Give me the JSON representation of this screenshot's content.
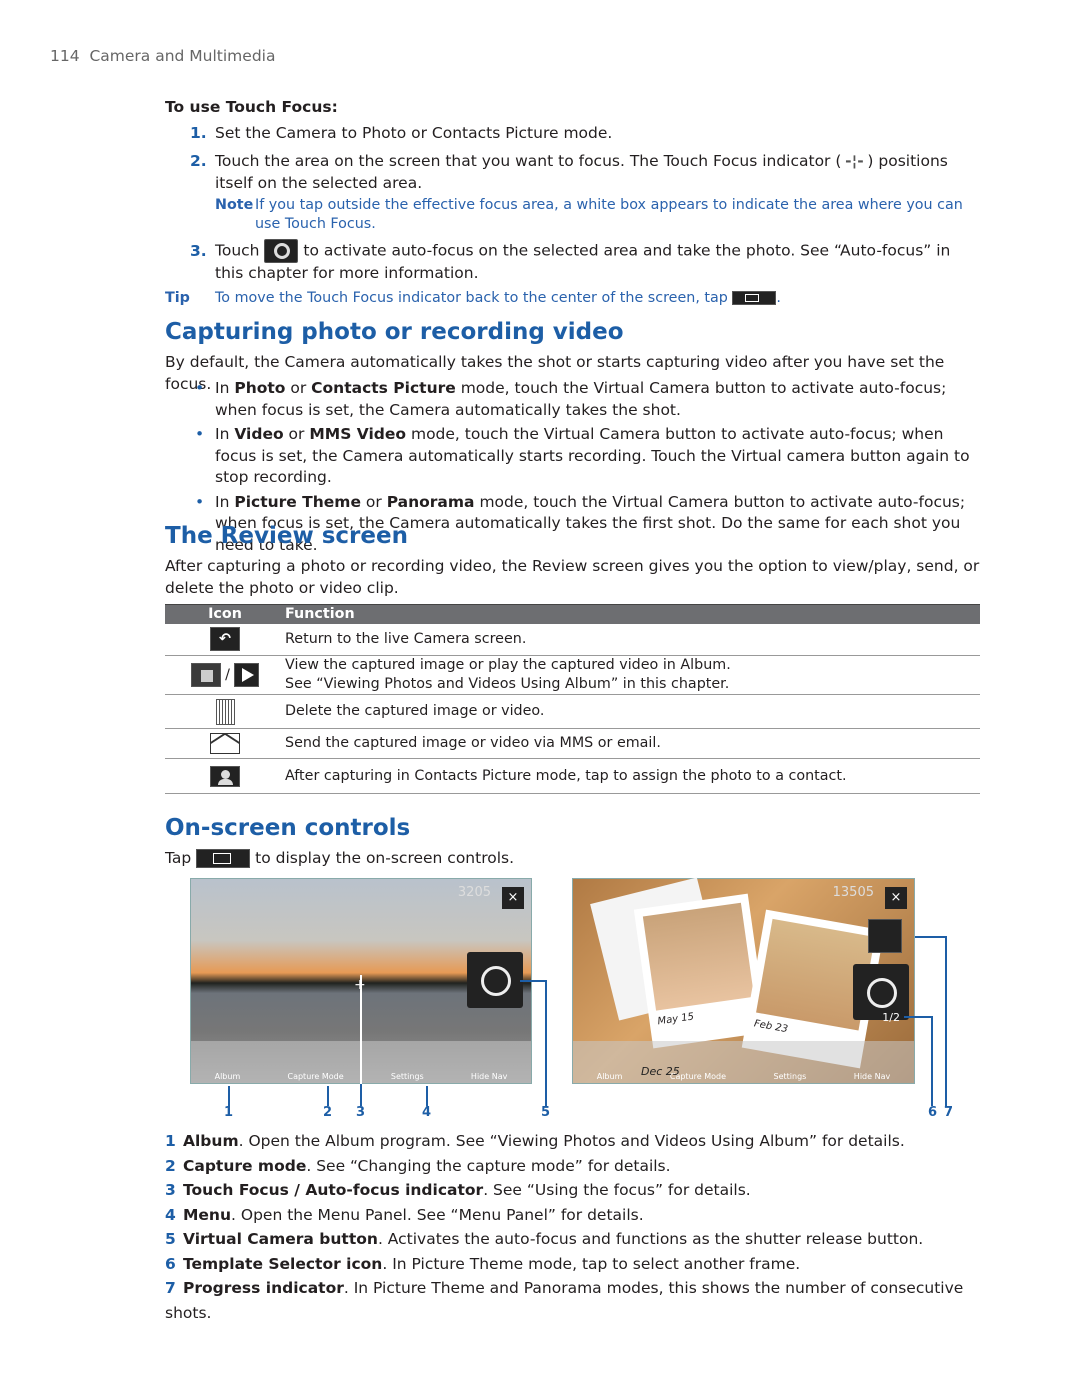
{
  "header": {
    "page_number": "114",
    "chapter": "Camera and Multimedia"
  },
  "touch_focus": {
    "heading": "To use Touch Focus:",
    "steps": [
      {
        "n": "1.",
        "text": "Set the Camera to Photo or Contacts Picture mode."
      },
      {
        "n": "2.",
        "text_a": "Touch the area on the screen that you want to focus. The Touch Focus indicator (",
        "text_b": ") positions itself on the selected area."
      },
      {
        "n": "3.",
        "text_a": "Touch",
        "text_b": "to activate auto-focus on the selected area and take the photo. See “Auto-focus” in this chapter for more information."
      }
    ],
    "note_label": "Note",
    "note": "If you tap outside the effective focus area, a white box appears to indicate the area where you can use Touch Focus.",
    "tip_label": "Tip",
    "tip": "To move the Touch Focus indicator back to the center of the screen, tap",
    "tip_end": "."
  },
  "capturing": {
    "title": "Capturing photo or recording video",
    "intro": "By default, the Camera automatically takes the shot or starts capturing video after you have set the focus.",
    "bullets": [
      [
        "In ",
        "Photo",
        " or ",
        "Contacts Picture",
        " mode, touch the Virtual Camera button to activate auto-focus; when focus is set, the Camera automatically takes the shot."
      ],
      [
        "In ",
        "Video",
        " or ",
        "MMS Video",
        " mode, touch the Virtual Camera button to activate auto-focus; when focus is set, the Camera automatically starts recording. Touch the Virtual camera button again to stop recording."
      ],
      [
        "In ",
        "Picture Theme",
        " or ",
        "Panorama",
        " mode, touch the Virtual Camera button to activate auto-focus; when focus is set, the Camera automatically takes the first shot. Do the same for each shot you need to take."
      ]
    ]
  },
  "review": {
    "title": "The Review screen",
    "intro": "After capturing a photo or recording video, the Review screen gives you the option to view/play, send, or delete the photo or video clip.",
    "columns": [
      "Icon",
      "Function"
    ],
    "rows": [
      {
        "icon": "back-arrow-icon",
        "function": "Return to the live Camera screen."
      },
      {
        "icon": "album-icon / play-icon",
        "separator": "/",
        "function": "View the captured image or play the captured video in Album.",
        "function2": "See “Viewing Photos and Videos Using Album” in this chapter."
      },
      {
        "icon": "trash-icon",
        "function": "Delete the captured image or video."
      },
      {
        "icon": "envelope-icon",
        "function": "Send the captured image or video via MMS or email."
      },
      {
        "icon": "contact-icon",
        "function": "After capturing in Contacts Picture mode, tap to assign the photo to a contact."
      }
    ]
  },
  "onscreen": {
    "title": "On-screen controls",
    "tap_a": "Tap",
    "tap_b": "to display the on-screen controls.",
    "shot1": {
      "counter": "3205",
      "close": "×",
      "nav": [
        "Album",
        "Capture Mode",
        "Settings",
        "Hide Nav"
      ]
    },
    "shot2": {
      "counter": "13505",
      "close": "×",
      "progress": "1/2",
      "nav": [
        "Album",
        "Capture Mode",
        "Settings",
        "Hide Nav"
      ],
      "captions": [
        "May 15",
        "Feb 23",
        "Dec 25"
      ]
    },
    "callouts": [
      "1",
      "2",
      "3",
      "4",
      "5",
      "6",
      "7"
    ],
    "items": [
      {
        "n": "1",
        "bold": "Album",
        "text": ". Open the Album program. See “Viewing Photos and Videos Using Album” for details."
      },
      {
        "n": "2",
        "bold": "Capture mode",
        "text": ". See “Changing the capture mode” for details."
      },
      {
        "n": "3",
        "bold": "Touch Focus / Auto-focus indicator",
        "text": ". See “Using the focus” for details."
      },
      {
        "n": "4",
        "bold": "Menu",
        "text": ". Open the Menu Panel. See “Menu Panel” for details."
      },
      {
        "n": "5",
        "bold": "Virtual Camera button",
        "text": ". Activates the auto-focus and functions as the shutter release button."
      },
      {
        "n": "6",
        "bold": "Template Selector icon",
        "text": ". In Picture Theme mode, tap to select another frame."
      },
      {
        "n": "7",
        "bold": "Progress indicator",
        "text": ". In Picture Theme and Panorama modes, this shows the number of consecutive shots."
      }
    ]
  },
  "colors": {
    "accent": "#1d5ea6",
    "table_header": "#6d6e71"
  }
}
